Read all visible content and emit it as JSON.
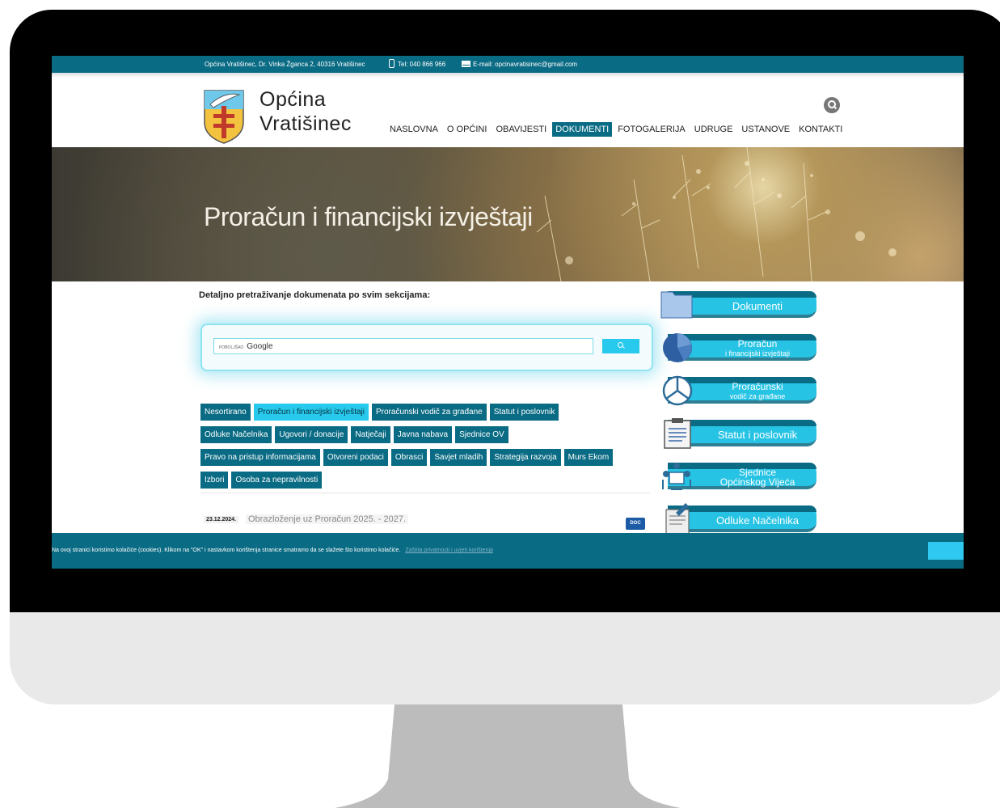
{
  "topbar": {
    "address": "Općina Vratišinec, Dr. Vinka Žganca 2, 40316 Vratišinec",
    "phone": "Tel: 040 866 966",
    "email": "E-mail: opcinavratisinec@gmail.com"
  },
  "site": {
    "name_line1": "Općina",
    "name_line2": "Vratišinec"
  },
  "nav": [
    "NASLOVNA",
    "O OPĆINI",
    "OBAVIJESTI",
    "DOKUMENTI",
    "FOTOGALERIJA",
    "UDRUGE",
    "USTANOVE",
    "KONTAKTI"
  ],
  "nav_active": "DOKUMENTI",
  "banner": {
    "title": "Proračun i financijski izvještaji"
  },
  "search": {
    "label": "Detaljno pretraživanje dokumenata po svim sekcijama:",
    "powered_by": "POBOLJŠAO",
    "brand": "Google"
  },
  "tags": {
    "row1": [
      "Nesortirano",
      "Proračun i financijski izvještaji",
      "Proračunski vodič za građane",
      "Statut i poslovnik"
    ],
    "row2": [
      "Odluke Načelnika",
      "Ugovori / donacije",
      "Natječaji",
      "Javna nabava",
      "Sjednice OV"
    ],
    "row3": [
      "Pravo na pristup informacijama",
      "Otvoreni podaci",
      "Obrasci",
      "Savjet mladih",
      "Strategija razvoja",
      "Murs Ekom"
    ],
    "row4": [
      "Izbori",
      "Osoba za nepravilnosti"
    ],
    "active": "Proračun i financijski izvještaji"
  },
  "document": {
    "date": "23.12.2024.",
    "title": "Obrazloženje uz Proračun 2025. - 2027.",
    "type": "DOC"
  },
  "sidebar": {
    "dokumenti": "Dokumenti",
    "proracun": "Proračun",
    "proracun_sub": "i financijski izvještaji",
    "vodic": "Proračunski",
    "vodic_sub": "vodič za građane",
    "statut": "Statut i poslovnik",
    "sjednice": "Sjednice",
    "sjednice_sub": "Općinskog Vijeća",
    "odluke": "Odluke Načelnika"
  },
  "cookie": {
    "text": "Na ovoj stranici koristimo kolačiće (cookies). Klikom na \"OK\" i nastavkom korištenja stranice smatramo da se slažete što koristimo kolačiće.",
    "link": "Zaštita privatnosti i uvjeti korištenja"
  },
  "colors": {
    "primary": "#0a6b84",
    "accent": "#27c9ec",
    "cookie_ok": "#2ec8f0"
  }
}
